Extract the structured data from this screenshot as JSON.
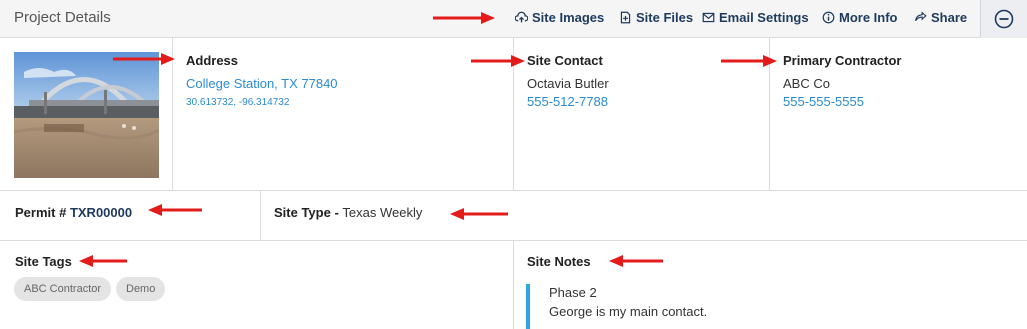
{
  "header": {
    "title": "Project Details",
    "actions": [
      {
        "label": "Site Images",
        "icon": "cloud-upload-icon"
      },
      {
        "label": "Site Files",
        "icon": "file-plus-icon"
      },
      {
        "label": "Email Settings",
        "icon": "envelope-icon"
      },
      {
        "label": "More Info",
        "icon": "info-circle-icon"
      },
      {
        "label": "Share",
        "icon": "share-icon"
      }
    ],
    "collapse_icon": "minus-circle-icon"
  },
  "address": {
    "label": "Address",
    "city": "College Station, TX 77840",
    "coords": "30.613732, -96.314732"
  },
  "site_contact": {
    "label": "Site Contact",
    "name": "Octavia Butler",
    "phone": "555-512-7788"
  },
  "primary_contractor": {
    "label": "Primary Contractor",
    "name": "ABC Co",
    "phone": "555-555-5555"
  },
  "permit": {
    "label": "Permit #",
    "value": "TXR00000"
  },
  "site_type": {
    "label": "Site Type -",
    "value": "Texas Weekly"
  },
  "site_tags": {
    "label": "Site Tags",
    "tags": [
      "ABC Contractor",
      "Demo"
    ]
  },
  "site_notes": {
    "label": "Site Notes",
    "title": "Phase 2",
    "body": "George is my main contact."
  },
  "colors": {
    "accent": "#2a8bd4",
    "header_action": "#1f3a5f",
    "note_bar": "#29a8e0",
    "arrow": "#e31b1b"
  }
}
